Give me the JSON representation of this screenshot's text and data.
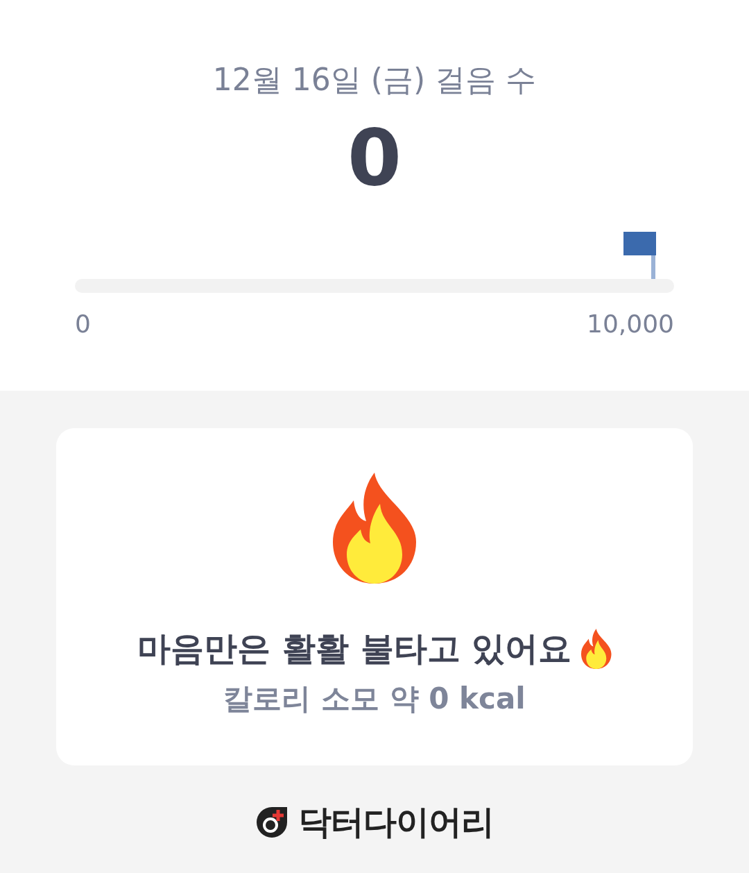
{
  "steps": {
    "title": "12월 16일 (금) 걸음 수",
    "count": "0",
    "level": 0,
    "min_label": "0",
    "goal_label": "10,000"
  },
  "card": {
    "message": "마음만은 활활 불타고 있어요",
    "calories": "칼로리 소모 약 0 kcal"
  },
  "brand": {
    "name": "닥터다이어리"
  }
}
